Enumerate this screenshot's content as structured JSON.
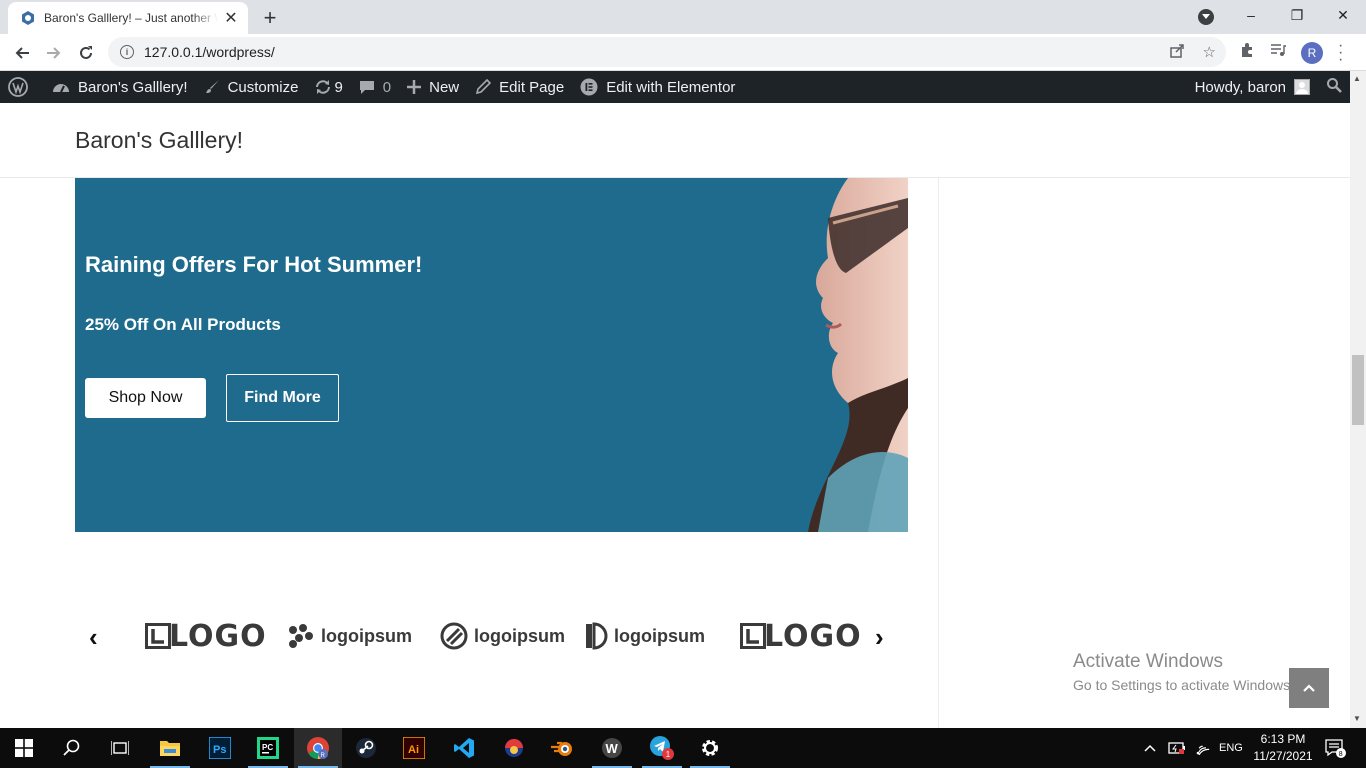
{
  "browser": {
    "tab_title": "Baron's Galllery! – Just another WordPress site",
    "new_tab": "+",
    "url": "127.0.0.1/wordpress/",
    "profile_initial": "R",
    "window_controls": {
      "minimize": "–",
      "restore": "❐",
      "close": "✕"
    }
  },
  "adminbar": {
    "site_name": "Baron's Galllery!",
    "customize": "Customize",
    "updates_count": "9",
    "comments_count": "0",
    "new": "New",
    "edit_page": "Edit Page",
    "edit_elementor": "Edit with Elementor",
    "howdy": "Howdy, baron"
  },
  "site": {
    "title": "Baron's Galllery!"
  },
  "hero": {
    "title": "Raining Offers For Hot Summer!",
    "subtitle": "25% Off On All Products",
    "shop_button": "Shop Now",
    "find_button": "Find More",
    "background_color": "#1e6b8e"
  },
  "logos": {
    "prev": "‹",
    "next": "›",
    "items": [
      "LOGO",
      "logoipsum",
      "logoipsum",
      "logoipsum",
      "LOGO"
    ]
  },
  "activation": {
    "title": "Activate Windows",
    "subtitle": "Go to Settings to activate Windows."
  },
  "taskbar": {
    "lang": "ENG",
    "time": "6:13 PM",
    "date": "11/27/2021",
    "notifications": "8",
    "telegram_badge": "1",
    "apps": [
      "start",
      "search",
      "task-view",
      "file-explorer",
      "photoshop",
      "pycharm",
      "chrome",
      "steam",
      "illustrator",
      "vscode",
      "app-circle",
      "blender",
      "wordpress-app",
      "telegram",
      "settings"
    ]
  }
}
